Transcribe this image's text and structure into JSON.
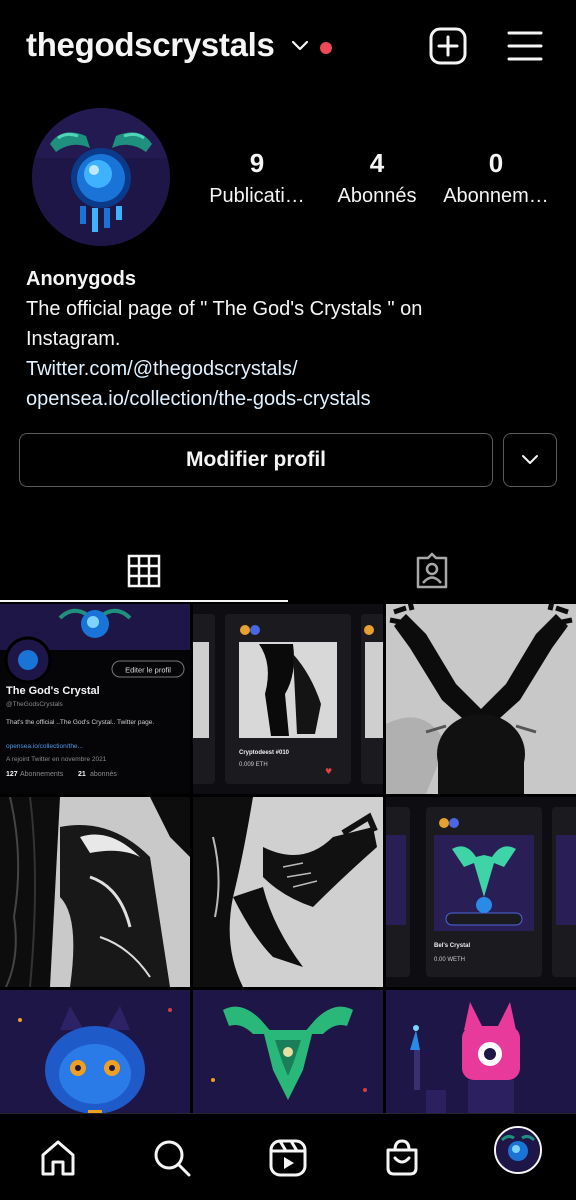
{
  "header": {
    "username": "thegodscrystals",
    "notification_color": "#ed4956"
  },
  "profile": {
    "stats": [
      {
        "value": "9",
        "label": "Publicati…"
      },
      {
        "value": "4",
        "label": "Abonnés"
      },
      {
        "value": "0",
        "label": "Abonnem…"
      }
    ],
    "name": "Anonygods",
    "bio_line1": "The official page of \" The God's Crystals \" on",
    "bio_line2": "Instagram.",
    "link1": "Twitter.com/@thegodscrystals/",
    "link2": "opensea.io/collection/the-gods-crystals"
  },
  "buttons": {
    "edit_profile": "Modifier profil"
  },
  "tabs": [
    {
      "icon": "grid-icon"
    },
    {
      "icon": "tagged-icon"
    }
  ],
  "post1": {
    "edit_label": "Editer le profil",
    "name": "The God's Crystal",
    "handle": "@TheGodsCrystals",
    "bio": "That's the official ..The God's Crystal.. Twitter page.",
    "link": "opensea.io/collection/the...",
    "joined": "A rejoint Twitter en novembre 2021",
    "following_count": "127",
    "following_label": "Abonnements",
    "followers_count": "21",
    "followers_label": "abonnés"
  },
  "post2": {
    "card_title": "Cryptodeest #010",
    "price": "0.009 ETH"
  },
  "post6": {
    "card_title": "Bel's Crystal",
    "price": "0.00 WETH"
  },
  "nav": [
    "home-icon",
    "search-icon",
    "reels-icon",
    "shop-icon",
    "profile-avatar"
  ]
}
